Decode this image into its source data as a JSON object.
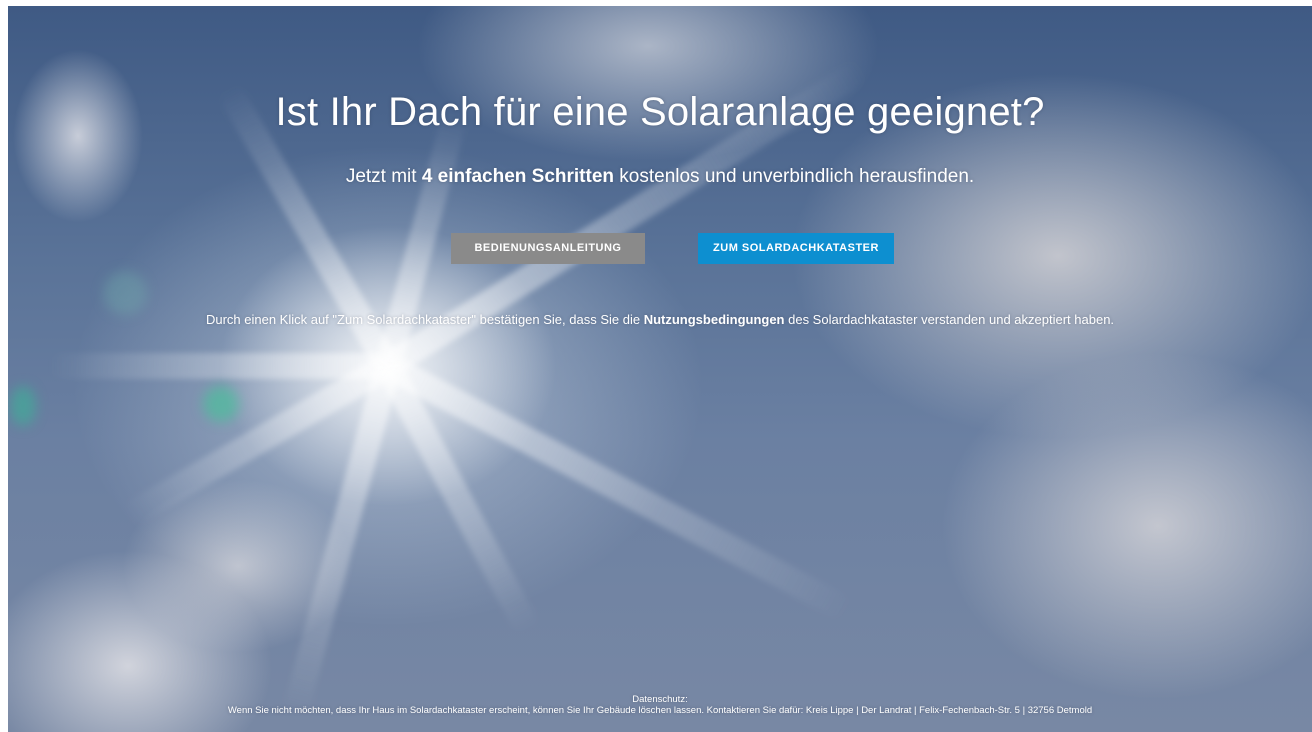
{
  "hero": {
    "title": "Ist Ihr Dach für eine Solaranlage geeignet?",
    "subtitle_prefix": "Jetzt mit ",
    "subtitle_bold": "4 einfachen Schritten",
    "subtitle_suffix": " kostenlos und unverbindlich herausfinden."
  },
  "buttons": {
    "guide_label": "BEDIENUNGSANLEITUNG",
    "guide_color": "#8a8a8a",
    "cadastre_label": "ZUM SOLARDACHKATASTER",
    "cadastre_color": "#0d8fd0"
  },
  "notice": {
    "prefix": "Durch einen Klick auf \"Zum Solardachkataster\" bestätigen Sie, dass Sie die ",
    "link": "Nutzungsbedingungen",
    "suffix": " des Solardachkataster verstanden und akzeptiert haben."
  },
  "footer": {
    "heading": "Datenschutz:",
    "text": "Wenn Sie nicht möchten, dass Ihr Haus im Solardachkataster erscheint, können Sie Ihr Gebäude löschen lassen. Kontaktieren Sie dafür: Kreis Lippe | Der Landrat | Felix-Fechenbach-Str. 5 | 32756 Detmold"
  },
  "background": {
    "image": "sun-sky-clouds-photo",
    "sky_color": "#5a7398"
  }
}
